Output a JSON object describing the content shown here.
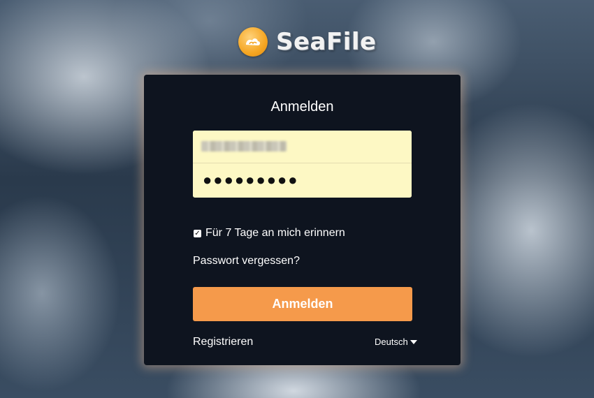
{
  "brand": {
    "name": "SeaFile",
    "icon": "seafile-logo-icon",
    "accent": "#f5a623"
  },
  "login": {
    "title": "Anmelden",
    "username_value": "",
    "password_mask": "●●●●●●●●●",
    "remember_label": "Für 7 Tage an mich erinnern",
    "remember_checked": true,
    "forgot_label": "Passwort vergessen?",
    "submit_label": "Anmelden",
    "submit_color": "#f59a4b",
    "register_label": "Registrieren",
    "language_label": "Deutsch"
  }
}
